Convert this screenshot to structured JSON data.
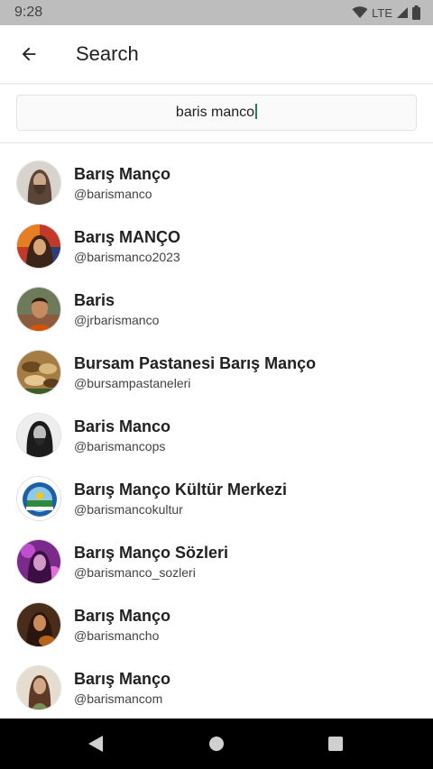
{
  "status_bar": {
    "time": "9:28",
    "network": "LTE"
  },
  "app_bar": {
    "title": "Search"
  },
  "search": {
    "query": "baris manco"
  },
  "results": [
    {
      "name": "Barış Manço",
      "handle": "@barismanco",
      "avatar_icon": "bearded-man-photo"
    },
    {
      "name": "Barış MANÇO",
      "handle": "@barismanco2023",
      "avatar_icon": "colorful-portrait-photo"
    },
    {
      "name": "Baris",
      "handle": "@jrbarismanco",
      "avatar_icon": "young-man-photo"
    },
    {
      "name": "Bursam Pastanesi Barış Manço",
      "handle": "@bursampastaneleri",
      "avatar_icon": "pastry-photo"
    },
    {
      "name": "Baris Manco",
      "handle": "@barismancops",
      "avatar_icon": "long-hair-man-photo"
    },
    {
      "name": "Barış Manço Kültür Merkezi",
      "handle": "@barismancokultur",
      "avatar_icon": "municipality-logo"
    },
    {
      "name": "Barış Manço Sözleri",
      "handle": "@barismanco_sozleri",
      "avatar_icon": "purple-portrait-photo"
    },
    {
      "name": "Barış Manço",
      "handle": "@barismancho",
      "avatar_icon": "guitar-man-photo"
    },
    {
      "name": "Barış Manço",
      "handle": "@barismancom",
      "avatar_icon": "vintage-man-photo"
    }
  ],
  "colors": {
    "status_bar": "#bdbdbd",
    "caret": "#1a7f6f",
    "nav_bar": "#000000"
  }
}
